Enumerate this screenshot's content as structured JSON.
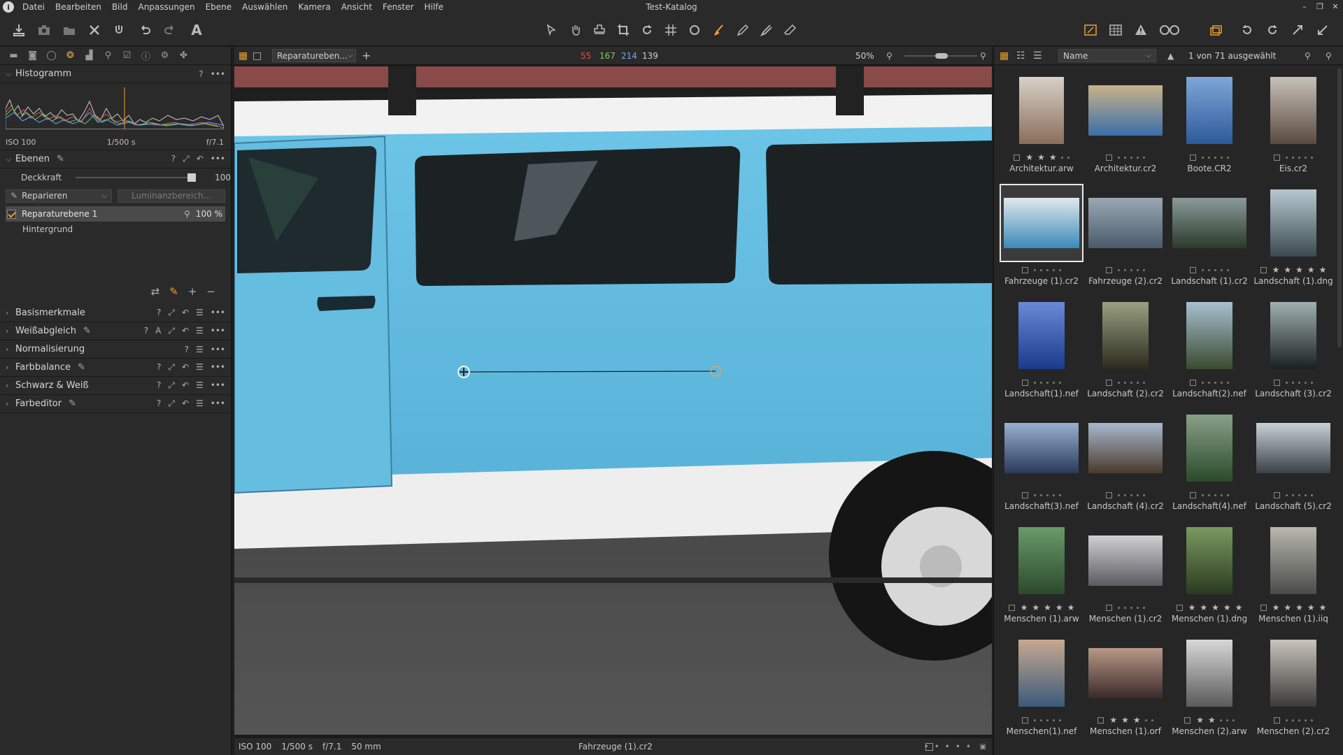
{
  "window": {
    "title": "Test-Katalog",
    "controls": [
      "–",
      "❐",
      "✕"
    ]
  },
  "menu": [
    "Datei",
    "Bearbeiten",
    "Bild",
    "Anpassungen",
    "Ebene",
    "Auswählen",
    "Kamera",
    "Ansicht",
    "Fenster",
    "Hilfe"
  ],
  "left_panel": {
    "histogram": {
      "title": "Histogramm",
      "iso": "ISO 100",
      "shutter": "1/500 s",
      "aperture": "f/7.1"
    },
    "layers": {
      "title": "Ebenen",
      "opacity_label": "Deckkraft",
      "opacity_value": "100",
      "opacity_level": 1.0,
      "mode": "Reparieren",
      "luminance_button": "Luminanzbereich...",
      "items": [
        {
          "name": "Reparaturebene 1",
          "opacity": "100 %",
          "selected": true
        },
        {
          "name": "Hintergrund",
          "selected": false
        }
      ]
    },
    "sections": [
      "Basismerkmale",
      "Weißabgleich",
      "Normalisierung",
      "Farbbalance",
      "Schwarz & Weiß",
      "Farbeditor"
    ]
  },
  "viewer": {
    "layer_dropdown": "Reparatureben...",
    "rgb": {
      "r": "55",
      "g": "167",
      "b": "214",
      "l": "139"
    },
    "zoom": "50%",
    "status": {
      "iso": "ISO 100",
      "shutter": "1/500 s",
      "aperture": "f/7.1",
      "focal": "50 mm",
      "filename": "Fahrzeuge (1).cr2"
    }
  },
  "browser": {
    "sort_label": "Name",
    "count_label": "1 von 71 ausgewählt",
    "thumbnails": [
      {
        "name": "Architektur.arw",
        "stars": 3,
        "c1": "#8a6e5a",
        "c2": "#d8d0c8",
        "w": 64,
        "h": 96
      },
      {
        "name": "Architektur.cr2",
        "stars": 0,
        "c1": "#3a6fa8",
        "c2": "#c9b28a",
        "w": 106,
        "h": 72
      },
      {
        "name": "Boote.CR2",
        "stars": 0,
        "c1": "#2d5a9a",
        "c2": "#7ea6d8",
        "w": 66,
        "h": 96
      },
      {
        "name": "Eis.cr2",
        "stars": 0,
        "c1": "#5a4a40",
        "c2": "#c8c0b8",
        "w": 66,
        "h": 96
      },
      {
        "name": "Fahrzeuge (1).cr2",
        "stars": 0,
        "c1": "#3a8ab8",
        "c2": "#e0e8ee",
        "w": 108,
        "h": 72,
        "selected": true
      },
      {
        "name": "Fahrzeuge (2).cr2",
        "stars": 0,
        "c1": "#4a5a6a",
        "c2": "#9aa8b4",
        "w": 106,
        "h": 72
      },
      {
        "name": "Landschaft (1).cr2",
        "stars": 0,
        "c1": "#2a3a2a",
        "c2": "#8a9a9a",
        "w": 106,
        "h": 72
      },
      {
        "name": "Landschaft (1).dng",
        "stars": 5,
        "c1": "#3a4a50",
        "c2": "#b8c8d0",
        "w": 66,
        "h": 96
      },
      {
        "name": "Landschaft(1).nef",
        "stars": 0,
        "c1": "#1a3a8a",
        "c2": "#6a8ad8",
        "w": 66,
        "h": 96
      },
      {
        "name": "Landschaft (2).cr2",
        "stars": 0,
        "c1": "#2a2a20",
        "c2": "#9aa080",
        "w": 66,
        "h": 96
      },
      {
        "name": "Landschaft(2).nef",
        "stars": 0,
        "c1": "#3a4a30",
        "c2": "#a8c0d0",
        "w": 66,
        "h": 96
      },
      {
        "name": "Landschaft (3).cr2",
        "stars": 0,
        "c1": "#1a2020",
        "c2": "#a0b0b0",
        "w": 66,
        "h": 96
      },
      {
        "name": "Landschaft(3).nef",
        "stars": 0,
        "c1": "#2a3a5a",
        "c2": "#9ab0d0",
        "w": 106,
        "h": 72
      },
      {
        "name": "Landschaft (4).cr2",
        "stars": 0,
        "c1": "#4a3a2a",
        "c2": "#a8b8d0",
        "w": 106,
        "h": 72
      },
      {
        "name": "Landschaft(4).nef",
        "stars": 0,
        "c1": "#2a4a2a",
        "c2": "#8aa088",
        "w": 66,
        "h": 96
      },
      {
        "name": "Landschaft (5).cr2",
        "stars": 0,
        "c1": "#3a4048",
        "c2": "#c8d0d8",
        "w": 106,
        "h": 72
      },
      {
        "name": "Menschen (1).arw",
        "stars": 5,
        "c1": "#2a4a2a",
        "c2": "#6a9a6a",
        "w": 66,
        "h": 96
      },
      {
        "name": "Menschen (1).cr2",
        "stars": 0,
        "c1": "#5a5a60",
        "c2": "#d0d0d4",
        "w": 106,
        "h": 72
      },
      {
        "name": "Menschen (1).dng",
        "stars": 5,
        "c1": "#2a3a20",
        "c2": "#7a9a60",
        "w": 66,
        "h": 96
      },
      {
        "name": "Menschen (1).iiq",
        "stars": 5,
        "c1": "#4a4a48",
        "c2": "#b8b8b0",
        "w": 66,
        "h": 96
      },
      {
        "name": "Menschen(1).nef",
        "stars": 0,
        "c1": "#3a5a7a",
        "c2": "#c8a890",
        "w": 66,
        "h": 96
      },
      {
        "name": "Menschen (1).orf",
        "stars": 3,
        "c1": "#3a2a2a",
        "c2": "#b89888",
        "w": 106,
        "h": 72
      },
      {
        "name": "Menschen (2).arw",
        "stars": 2,
        "c1": "#5a5a5a",
        "c2": "#d8d8d8",
        "w": 66,
        "h": 96
      },
      {
        "name": "Menschen (2).cr2",
        "stars": 0,
        "c1": "#3a3a38",
        "c2": "#c8c4bc",
        "w": 66,
        "h": 96
      }
    ]
  },
  "colors": {
    "accent": "#f0a030",
    "red": "#e05050",
    "green": "#7ad060",
    "blue": "#6aa8ff"
  }
}
